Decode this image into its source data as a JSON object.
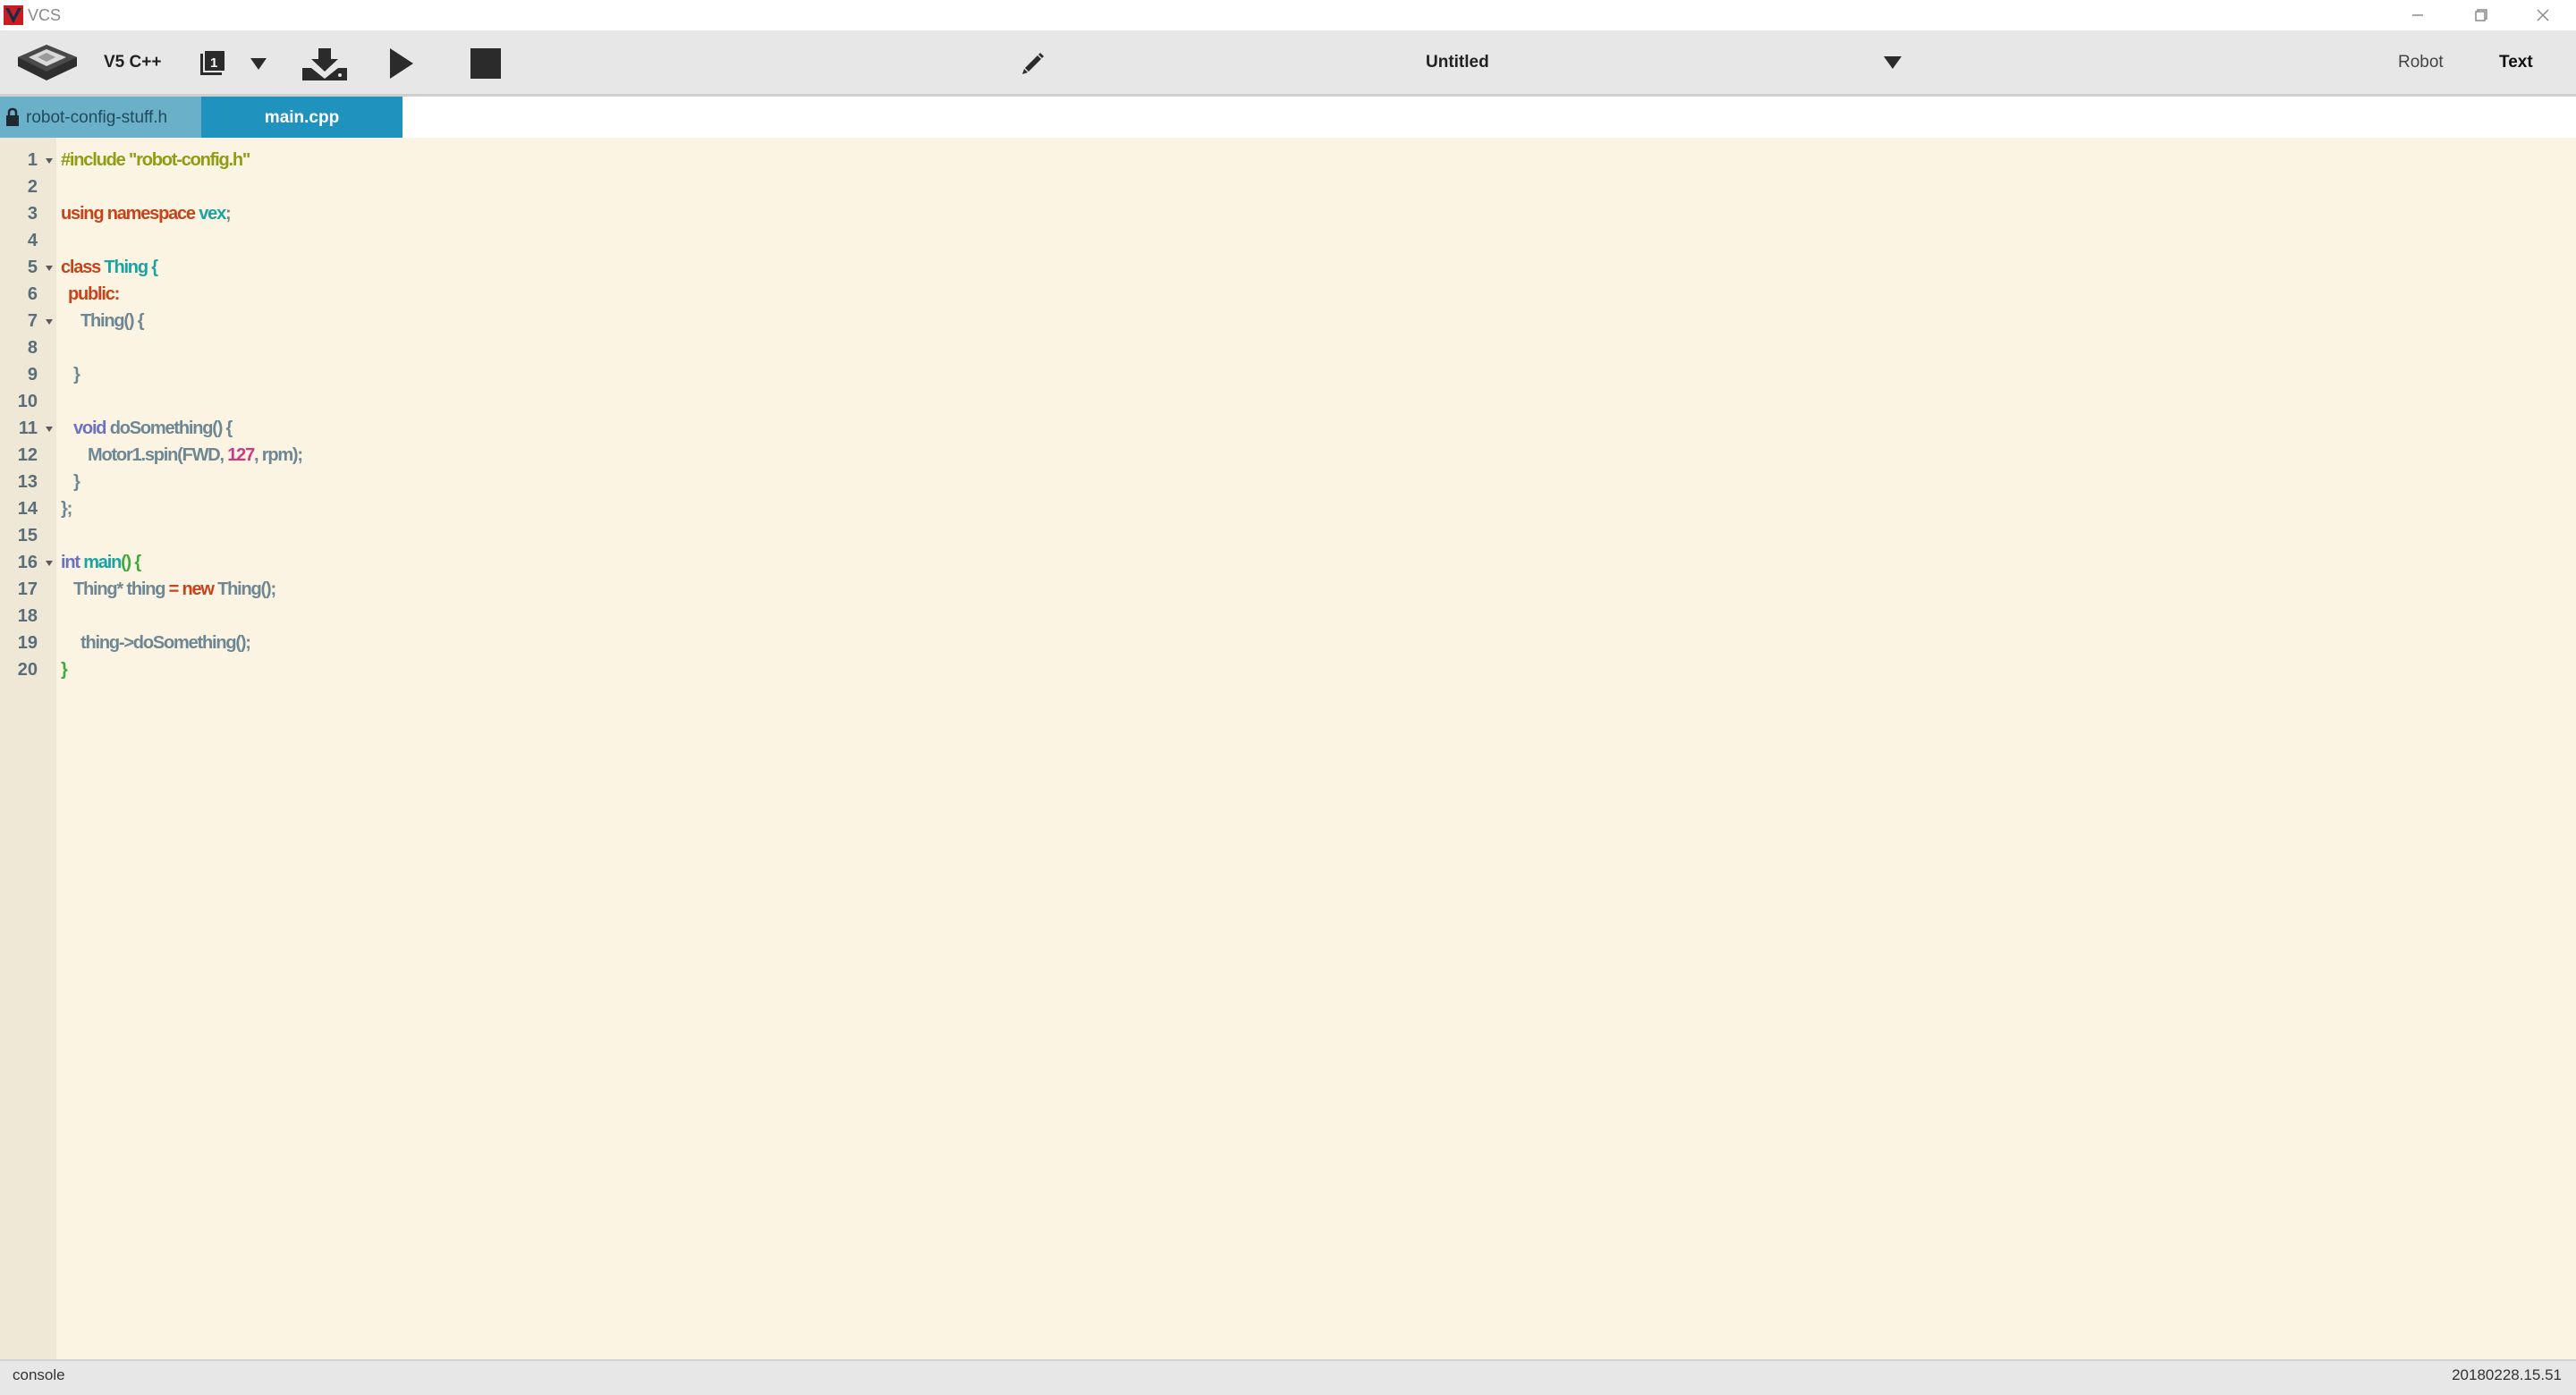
{
  "window": {
    "title": "VCS",
    "logo_icon": "vex-logo-icon",
    "controls": [
      "minimize-icon",
      "restore-icon",
      "close-icon"
    ]
  },
  "toolbar": {
    "device_icon": "v5-brain-icon",
    "language": "V5 C++",
    "slot_number": "1",
    "slot_icon": "slot-icon",
    "download_icon": "download-icon",
    "run_icon": "play-icon",
    "stop_icon": "stop-icon",
    "edit_icon": "pencil-icon",
    "project_name": "Untitled",
    "modes": {
      "robot": "Robot",
      "text": "Text",
      "active": "Text"
    }
  },
  "tabs": [
    {
      "label": "robot-config-stuff.h",
      "locked": true,
      "active": false
    },
    {
      "label": "main.cpp",
      "locked": false,
      "active": true
    }
  ],
  "editor": {
    "lines": [
      {
        "n": "1",
        "fold": true
      },
      {
        "n": "2",
        "fold": false
      },
      {
        "n": "3",
        "fold": false
      },
      {
        "n": "4",
        "fold": false
      },
      {
        "n": "5",
        "fold": true
      },
      {
        "n": "6",
        "fold": false
      },
      {
        "n": "7",
        "fold": true
      },
      {
        "n": "8",
        "fold": false
      },
      {
        "n": "9",
        "fold": false
      },
      {
        "n": "10",
        "fold": false
      },
      {
        "n": "11",
        "fold": true
      },
      {
        "n": "12",
        "fold": false
      },
      {
        "n": "13",
        "fold": false
      },
      {
        "n": "14",
        "fold": false
      },
      {
        "n": "15",
        "fold": false
      },
      {
        "n": "16",
        "fold": true
      },
      {
        "n": "17",
        "fold": false
      },
      {
        "n": "18",
        "fold": false
      },
      {
        "n": "19",
        "fold": false
      },
      {
        "n": "20",
        "fold": false
      }
    ],
    "tokens": {
      "l1_pre": "#include \"robot-config.h\"",
      "l3_using": "using",
      "l3_namespace": "namespace",
      "l3_vex": "vex",
      "l3_semi": ";",
      "l5_class": "class",
      "l5_thing": "Thing",
      "l5_brace": "{",
      "l6_public": "public:",
      "l7_ctor": "Thing() {",
      "l9_close": "}",
      "l11_void": "void",
      "l11_rest": "doSomething() {",
      "l12_a": "Motor1.spin(FWD, ",
      "l12_num": "127",
      "l12_b": ", rpm);",
      "l13_close": "}",
      "l14_close": "};",
      "l16_int": "int",
      "l16_main": "main",
      "l16_rest": "() {",
      "l17_a": "Thing* thing ",
      "l17_eq": "=",
      "l17_new": "new",
      "l17_b": "Thing();",
      "l19": "thing->doSomething();",
      "l20_close": "}"
    }
  },
  "statusbar": {
    "left": "console",
    "right": "20180228.15.51"
  },
  "colors": {
    "editor_bg": "#fbf4e2",
    "gutter_bg": "#efe8d7",
    "toolbar_bg": "#e7e7e7",
    "tab_inactive": "#6bb0c9",
    "tab_active": "#1f93bd",
    "keyword": "#c8431a",
    "type": "#1aa3a3",
    "preprocessor": "#8f9d12",
    "number": "#d33682",
    "default_text": "#6e8794"
  }
}
